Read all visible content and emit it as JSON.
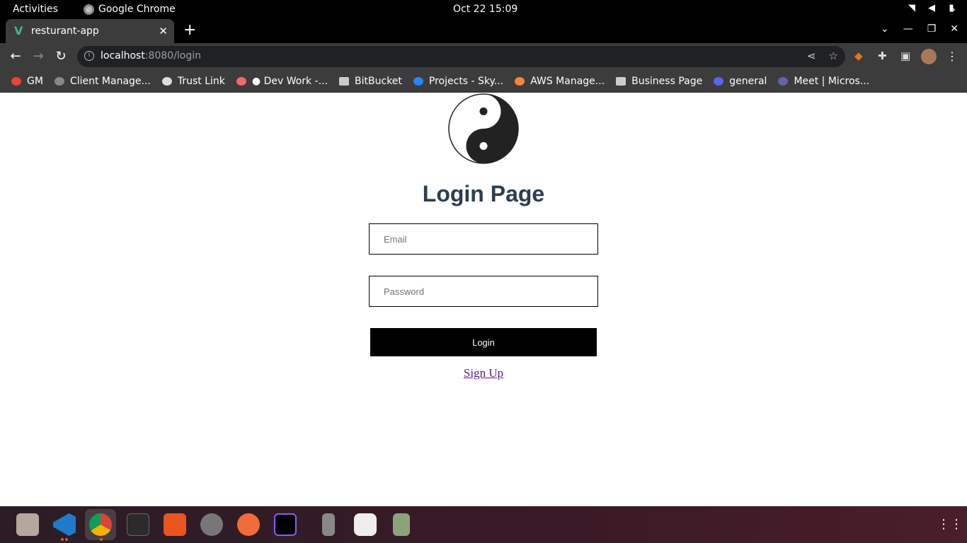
{
  "system_bar": {
    "activities": "Activities",
    "app_name": "Google Chrome",
    "datetime": "Oct 22  15:09"
  },
  "browser": {
    "tab_title": "resturant-app",
    "url_host": "localhost",
    "url_path": ":8080/login",
    "bookmarks": [
      {
        "label": "GM",
        "icon": "gmail-icon"
      },
      {
        "label": "Client Manage...",
        "icon": "globe-icon"
      },
      {
        "label": "Trust Link",
        "icon": "link-icon"
      },
      {
        "label": "● Dev Work -...",
        "icon": "asana-icon"
      },
      {
        "label": "BitBucket",
        "icon": "folder-icon"
      },
      {
        "label": "Projects - Sky...",
        "icon": "jira-icon"
      },
      {
        "label": "AWS Manage...",
        "icon": "aws-icon"
      },
      {
        "label": "Business Page",
        "icon": "folder-icon"
      },
      {
        "label": "general",
        "icon": "discord-icon"
      },
      {
        "label": "Meet | Micros...",
        "icon": "teams-icon"
      }
    ]
  },
  "login": {
    "title": "Login Page",
    "email_placeholder": "Email",
    "password_placeholder": "Password",
    "login_button": "Login",
    "signup_link": "Sign Up"
  },
  "colors": {
    "heading": "#2c3e50",
    "button_bg": "#000000",
    "link": "#551a8b"
  }
}
